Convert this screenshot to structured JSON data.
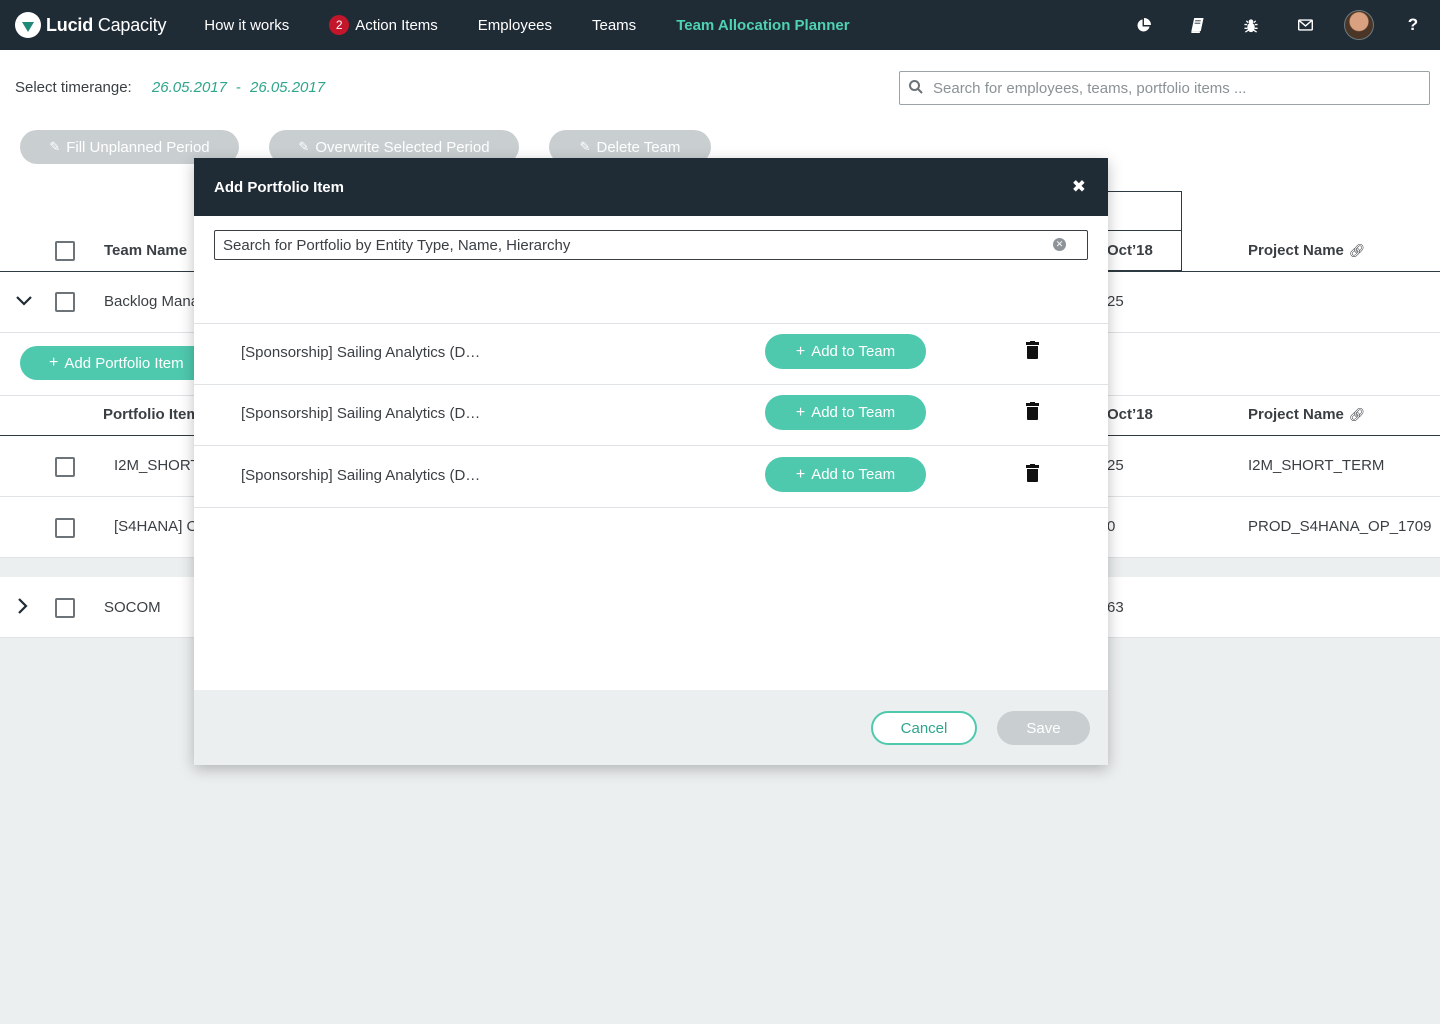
{
  "nav": {
    "brand_bold": "Lucid",
    "brand_rest": "Capacity",
    "links": [
      {
        "label": "How it works"
      },
      {
        "label": "Action Items",
        "badge": "2"
      },
      {
        "label": "Employees"
      },
      {
        "label": "Teams"
      },
      {
        "label": "Team Allocation Planner",
        "active": true
      }
    ],
    "icons": [
      "pie-chart-icon",
      "book-icon",
      "bug-icon",
      "mail-icon",
      "avatar",
      "help-icon"
    ],
    "help_glyph": "?"
  },
  "timerange": {
    "label": "Select timerange:",
    "from": "26.05.2017",
    "separator": "-",
    "to": "26.05.2017"
  },
  "search": {
    "placeholder": "Search for employees, teams, portfolio items ..."
  },
  "toolbar": {
    "fill_label": "Fill Unplanned Period",
    "overwrite_label": "Overwrite Selected Period",
    "delete_label": "Delete Team"
  },
  "table": {
    "team_header": "Team Name",
    "month_header": "Oct’18",
    "project_header": "Project Name",
    "teams": [
      {
        "name": "Backlog Mana",
        "value": "25",
        "expanded": true
      },
      {
        "name": "SOCOM",
        "value": "63",
        "expanded": false
      }
    ],
    "add_portfolio_label": "Add Portfolio Item",
    "portfolio_header": "Portfolio Item",
    "portfolio_rows": [
      {
        "name": "I2M_SHORT",
        "value": "25",
        "project": "I2M_SHORT_TERM"
      },
      {
        "name": "[S4HANA] O",
        "value": "0",
        "project": "PROD_S4HANA_OP_1709"
      }
    ]
  },
  "modal": {
    "title": "Add Portfolio Item",
    "close_glyph": "✖",
    "search_placeholder": "Search for Portfolio by Entity Type, Name, Hierarchy",
    "items": [
      {
        "name": "[Sponsorship] Sailing Analytics (D…",
        "button": "Add to Team"
      },
      {
        "name": "[Sponsorship] Sailing Analytics (D…",
        "button": "Add to Team"
      },
      {
        "name": "[Sponsorship] Sailing Analytics (D…",
        "button": "Add to Team"
      }
    ],
    "cancel_label": "Cancel",
    "save_label": "Save"
  },
  "colors": {
    "nav_bg": "#1f2b35",
    "accent": "#4fc9ae",
    "accent_text": "#2ea58c",
    "badge": "#c4162b",
    "disabled": "#c9cfd1"
  }
}
